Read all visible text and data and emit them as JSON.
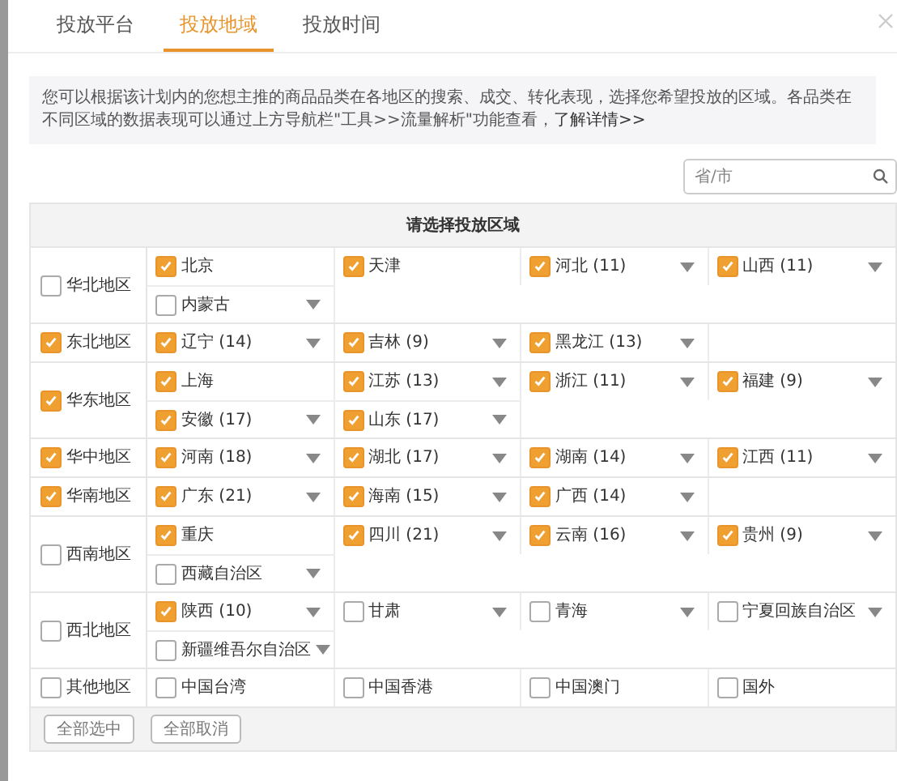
{
  "tabs": [
    {
      "label": "投放平台",
      "selected": false
    },
    {
      "label": "投放地域",
      "selected": true
    },
    {
      "label": "投放时间",
      "selected": false
    }
  ],
  "notice": {
    "text": "您可以根据该计划内的您想主推的商品品类在各地区的搜索、成交、转化表现，选择您希望投放的区域。各品类在不同区域的数据表现可以通过上方导航栏\"工具>>流量解析\"功能查看，",
    "link": "了解详情>>"
  },
  "search": {
    "placeholder": "省/市"
  },
  "table": {
    "title": "请选择投放区域",
    "regions": [
      {
        "name": "华北地区",
        "checked": false,
        "provinces": [
          {
            "label": "北京",
            "checked": true,
            "expandable": false
          },
          {
            "label": "天津",
            "checked": true,
            "expandable": false
          },
          {
            "label": "河北 (11)",
            "checked": true,
            "expandable": true
          },
          {
            "label": "山西 (11)",
            "checked": true,
            "expandable": true
          },
          {
            "label": "内蒙古",
            "checked": false,
            "expandable": true
          }
        ]
      },
      {
        "name": "东北地区",
        "checked": true,
        "provinces": [
          {
            "label": "辽宁 (14)",
            "checked": true,
            "expandable": true
          },
          {
            "label": "吉林 (9)",
            "checked": true,
            "expandable": true
          },
          {
            "label": "黑龙江 (13)",
            "checked": true,
            "expandable": true
          }
        ]
      },
      {
        "name": "华东地区",
        "checked": true,
        "provinces": [
          {
            "label": "上海",
            "checked": true,
            "expandable": false
          },
          {
            "label": "江苏 (13)",
            "checked": true,
            "expandable": true
          },
          {
            "label": "浙江 (11)",
            "checked": true,
            "expandable": true
          },
          {
            "label": "福建 (9)",
            "checked": true,
            "expandable": true
          },
          {
            "label": "安徽 (17)",
            "checked": true,
            "expandable": true
          },
          {
            "label": "山东 (17)",
            "checked": true,
            "expandable": true
          }
        ]
      },
      {
        "name": "华中地区",
        "checked": true,
        "provinces": [
          {
            "label": "河南 (18)",
            "checked": true,
            "expandable": true
          },
          {
            "label": "湖北 (17)",
            "checked": true,
            "expandable": true
          },
          {
            "label": "湖南 (14)",
            "checked": true,
            "expandable": true
          },
          {
            "label": "江西 (11)",
            "checked": true,
            "expandable": true
          }
        ]
      },
      {
        "name": "华南地区",
        "checked": true,
        "provinces": [
          {
            "label": "广东 (21)",
            "checked": true,
            "expandable": true
          },
          {
            "label": "海南 (15)",
            "checked": true,
            "expandable": true
          },
          {
            "label": "广西 (14)",
            "checked": true,
            "expandable": true
          }
        ]
      },
      {
        "name": "西南地区",
        "checked": false,
        "provinces": [
          {
            "label": "重庆",
            "checked": true,
            "expandable": false
          },
          {
            "label": "四川 (21)",
            "checked": true,
            "expandable": true
          },
          {
            "label": "云南 (16)",
            "checked": true,
            "expandable": true
          },
          {
            "label": "贵州 (9)",
            "checked": true,
            "expandable": true
          },
          {
            "label": "西藏自治区",
            "checked": false,
            "expandable": true
          }
        ]
      },
      {
        "name": "西北地区",
        "checked": false,
        "provinces": [
          {
            "label": "陕西 (10)",
            "checked": true,
            "expandable": true
          },
          {
            "label": "甘肃",
            "checked": false,
            "expandable": true
          },
          {
            "label": "青海",
            "checked": false,
            "expandable": true
          },
          {
            "label": "宁夏回族自治区",
            "checked": false,
            "expandable": true
          },
          {
            "label": "新疆维吾尔自治区",
            "checked": false,
            "expandable": true
          }
        ]
      },
      {
        "name": "其他地区",
        "checked": false,
        "provinces": [
          {
            "label": "中国台湾",
            "checked": false,
            "expandable": false
          },
          {
            "label": "中国香港",
            "checked": false,
            "expandable": false
          },
          {
            "label": "中国澳门",
            "checked": false,
            "expandable": false
          },
          {
            "label": "国外",
            "checked": false,
            "expandable": false
          }
        ]
      }
    ]
  },
  "buttons": [
    "全部选中",
    "全部取消"
  ]
}
